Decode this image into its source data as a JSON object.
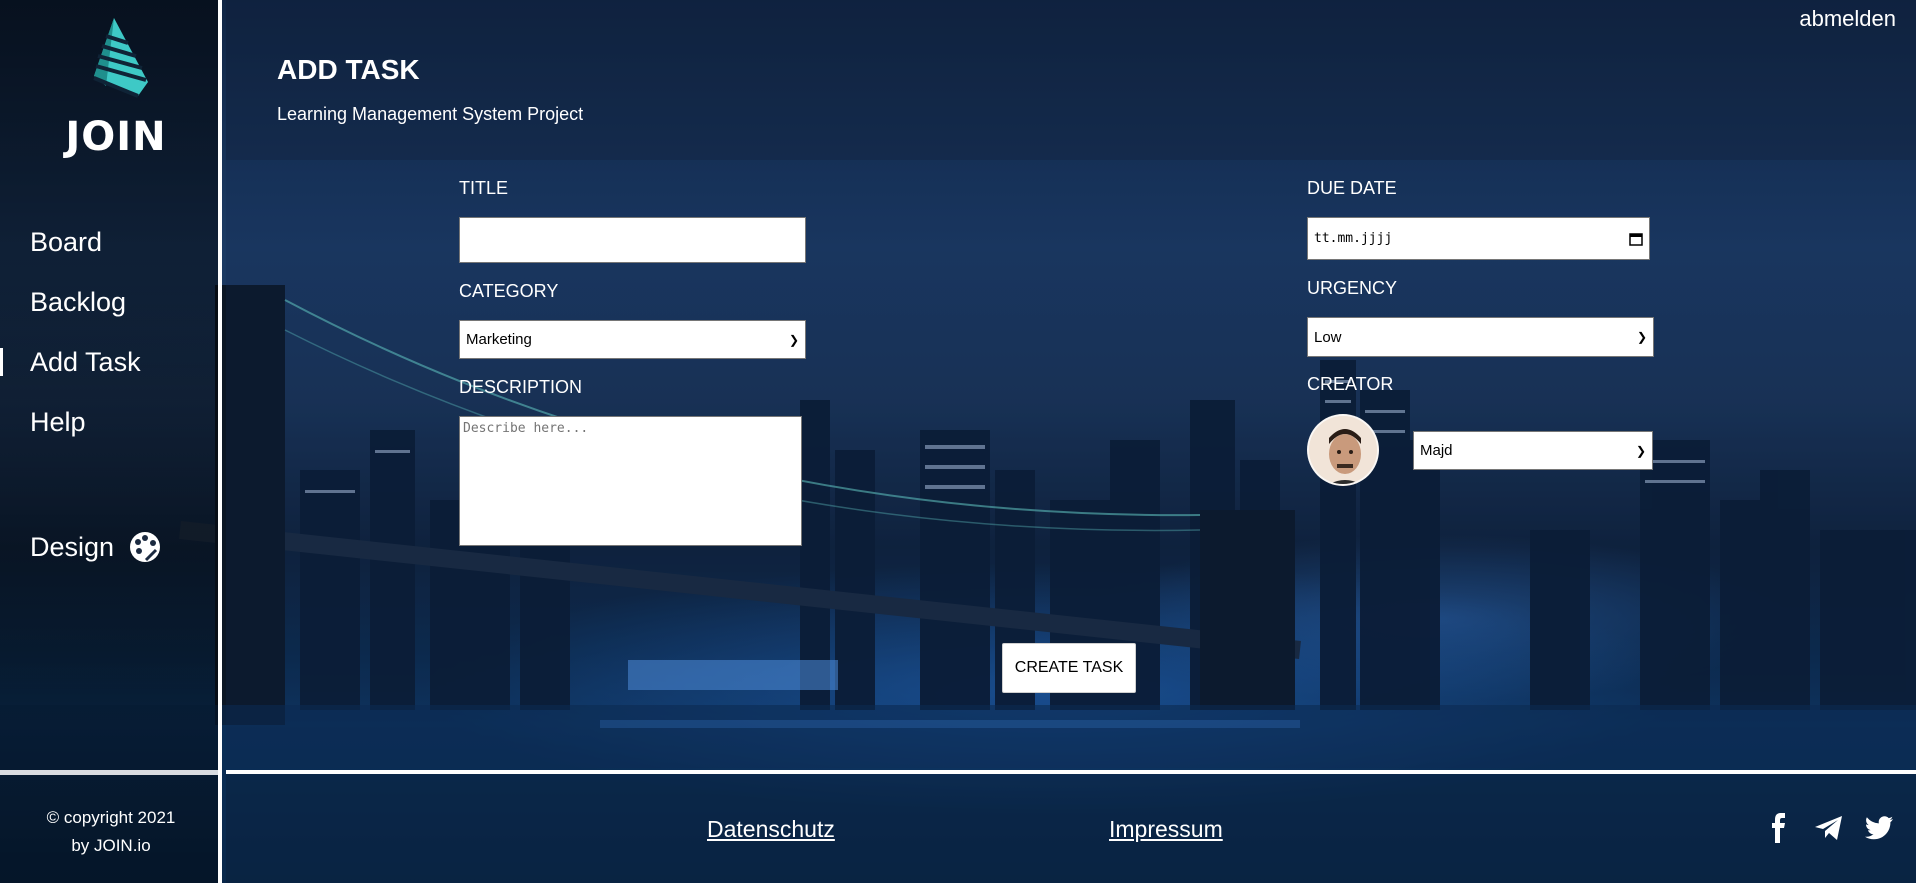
{
  "sidebar": {
    "logo_text": "JOIN",
    "nav": [
      {
        "label": "Board"
      },
      {
        "label": "Backlog"
      },
      {
        "label": "Add Task"
      },
      {
        "label": "Help"
      }
    ],
    "design_label": "Design",
    "copyright_line1": "© copyright 2021",
    "copyright_line2": "by JOIN.io"
  },
  "header": {
    "title": "ADD TASK",
    "subtitle": "Learning Management System Project",
    "logout": "abmelden"
  },
  "form": {
    "title_label": "TITLE",
    "title_value": "",
    "category_label": "CATEGORY",
    "category_value": "Marketing",
    "description_label": "DESCRIPTION",
    "description_placeholder": "Describe here...",
    "due_date_label": "DUE DATE",
    "due_date_value": "tt.mm.jjjj",
    "urgency_label": "URGENCY",
    "urgency_value": "Low",
    "creator_label": "CREATOR",
    "creator_value": "Majd",
    "create_button": "CREATE TASK"
  },
  "footer": {
    "privacy": "Datenschutz",
    "imprint": "Impressum",
    "social_icons": [
      "facebook-icon",
      "telegram-icon",
      "twitter-icon"
    ]
  },
  "colors": {
    "accent_logo": "#3ec9c6",
    "white": "#ffffff"
  }
}
